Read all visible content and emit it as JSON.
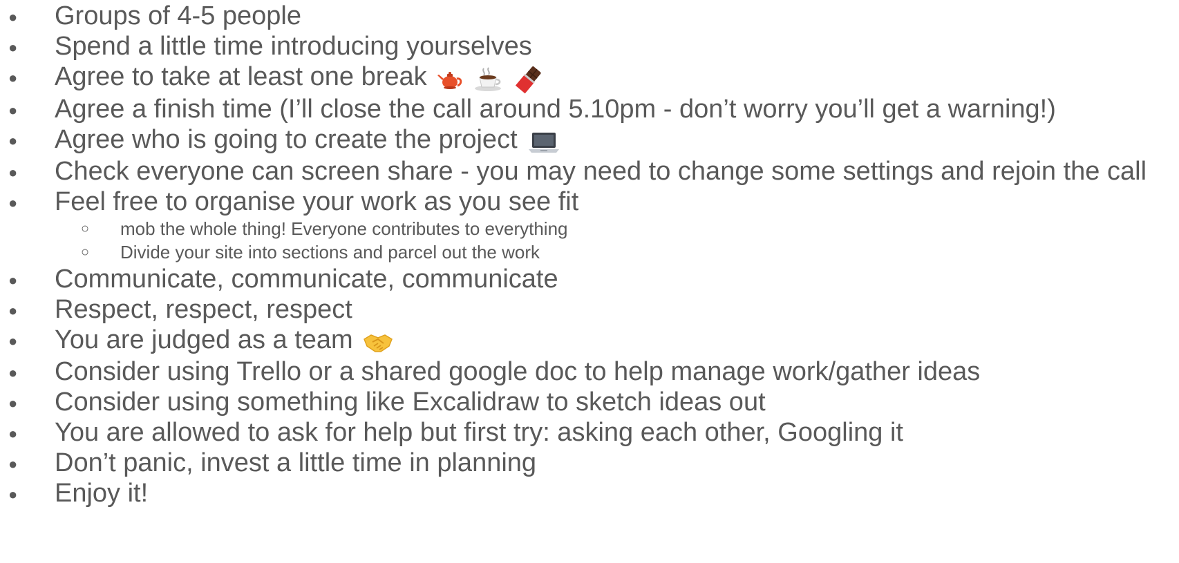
{
  "items": [
    {
      "text": "Groups of 4-5 people"
    },
    {
      "text": "Spend a little time introducing yourselves"
    },
    {
      "text": "Agree to take at least one break",
      "emojis": [
        "teapot-icon",
        "hot-beverage-icon",
        "chocolate-bar-icon"
      ]
    },
    {
      "text": "Agree a finish time (I’ll close the call around 5.10pm - don’t worry you’ll get a warning!)"
    },
    {
      "text": "Agree who is going to create the project",
      "emojis": [
        "laptop-icon"
      ]
    },
    {
      "text": "Check everyone can screen share - you may need to change some settings and rejoin the call"
    },
    {
      "text": "Feel free to organise your work as you see fit",
      "subitems": [
        "mob the whole thing! Everyone contributes to everything",
        "Divide your site into sections and parcel out the work"
      ]
    },
    {
      "text": "Communicate, communicate, communicate"
    },
    {
      "text": "Respect, respect, respect"
    },
    {
      "text": "You are judged as a team",
      "emojis": [
        "handshake-icon"
      ]
    },
    {
      "text": "Consider using Trello or a shared google doc to help manage work/gather ideas"
    },
    {
      "text": "Consider using something like Excalidraw to sketch ideas out"
    },
    {
      "text": "You are allowed to ask for help but first try: asking each other, Googling it"
    },
    {
      "text": "Don’t panic, invest a little time in planning"
    },
    {
      "text": "Enjoy it!"
    }
  ],
  "bullet_glyph": "●",
  "sub_bullet_glyph": "○",
  "colors": {
    "text": "#595959",
    "background": "#ffffff"
  }
}
